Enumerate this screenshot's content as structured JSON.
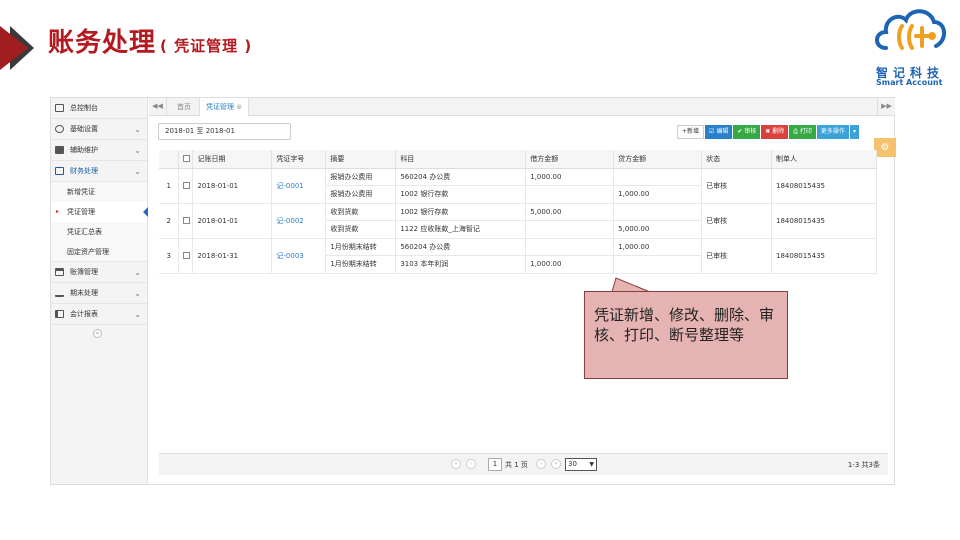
{
  "header": {
    "title": "账务处理",
    "subtitle": "( 凭证管理 )"
  },
  "logo": {
    "cn": "智记科技",
    "en": "Smart Account"
  },
  "sidebar": {
    "items": [
      {
        "label": "总控制台",
        "icon": "monitor-icon"
      },
      {
        "label": "基础设置",
        "icon": "gears-icon",
        "chevron": "⌄"
      },
      {
        "label": "辅助维护",
        "icon": "keyboard-icon",
        "chevron": "⌄"
      },
      {
        "label": "财务处理",
        "icon": "finance-icon",
        "chevron": "⌄"
      }
    ],
    "subitems": [
      {
        "label": "新增凭证"
      },
      {
        "label": "凭证管理",
        "mark": "▸"
      },
      {
        "label": "凭证汇总表"
      },
      {
        "label": "固定资产管理"
      }
    ],
    "items_after": [
      {
        "label": "账簿管理",
        "icon": "card-icon",
        "chevron": "⌄"
      },
      {
        "label": "期末处理",
        "icon": "scale-icon",
        "chevron": "⌄"
      },
      {
        "label": "会计报表",
        "icon": "list-icon",
        "chevron": "⌄"
      }
    ],
    "collapse_glyph": "«"
  },
  "tabs": {
    "prev": "◀◀",
    "next": "▶▶",
    "home": "首页",
    "active": "凭证管理",
    "active_close": "⊗"
  },
  "toolbar": {
    "date_range": "2018-01 至 2018-01",
    "add": "+新增",
    "edit": "☑ 编辑",
    "audit": "✔ 审核",
    "delete": "✖ 删除",
    "print": "⎙ 打印",
    "more": "更多操作",
    "more_caret": "▾",
    "settings_glyph": "⚙"
  },
  "table": {
    "headers": [
      "",
      "",
      "记账日期",
      "凭证字号",
      "摘要",
      "科目",
      "借方金额",
      "贷方金额",
      "状态",
      "制单人"
    ],
    "vouchers": [
      {
        "index": "1",
        "date": "2018-01-01",
        "number": "记-0001",
        "status": "已审核",
        "maker": "18408015435",
        "lines": [
          {
            "summary": "报销办公费用",
            "account": "560204 办公费",
            "debit": "1,000.00",
            "credit": ""
          },
          {
            "summary": "报销办公费用",
            "account": "1002 银行存款",
            "debit": "",
            "credit": "1,000.00"
          }
        ]
      },
      {
        "index": "2",
        "date": "2018-01-01",
        "number": "记-0002",
        "status": "已审核",
        "maker": "18408015435",
        "lines": [
          {
            "summary": "收到货款",
            "account": "1002 银行存款",
            "debit": "5,000.00",
            "credit": ""
          },
          {
            "summary": "收到货款",
            "account": "1122 应收账款_上海智记",
            "debit": "",
            "credit": "5,000.00"
          }
        ]
      },
      {
        "index": "3",
        "date": "2018-01-31",
        "number": "记-0003",
        "status": "已审核",
        "maker": "18408015435",
        "lines": [
          {
            "summary": "1月份期末结转",
            "account": "560204 办公费",
            "debit": "",
            "credit": "1,000.00"
          },
          {
            "summary": "1月份期末结转",
            "account": "3103 本年利润",
            "debit": "1,000.00",
            "credit": ""
          }
        ]
      }
    ]
  },
  "pager": {
    "first": "«",
    "prev": "‹",
    "page": "1",
    "of_pages": "共 1 页",
    "next": "›",
    "last": "»",
    "page_size": "30",
    "summary": "1-3 共3条"
  },
  "callout": {
    "text": "凭证新增、修改、删除、审核、打印、断号整理等"
  },
  "colors": {
    "title_red": "#b3191e",
    "link_blue": "#2a7fc9",
    "callout_fill": "#e6b3b3",
    "logo_blue": "#1e64b4"
  }
}
